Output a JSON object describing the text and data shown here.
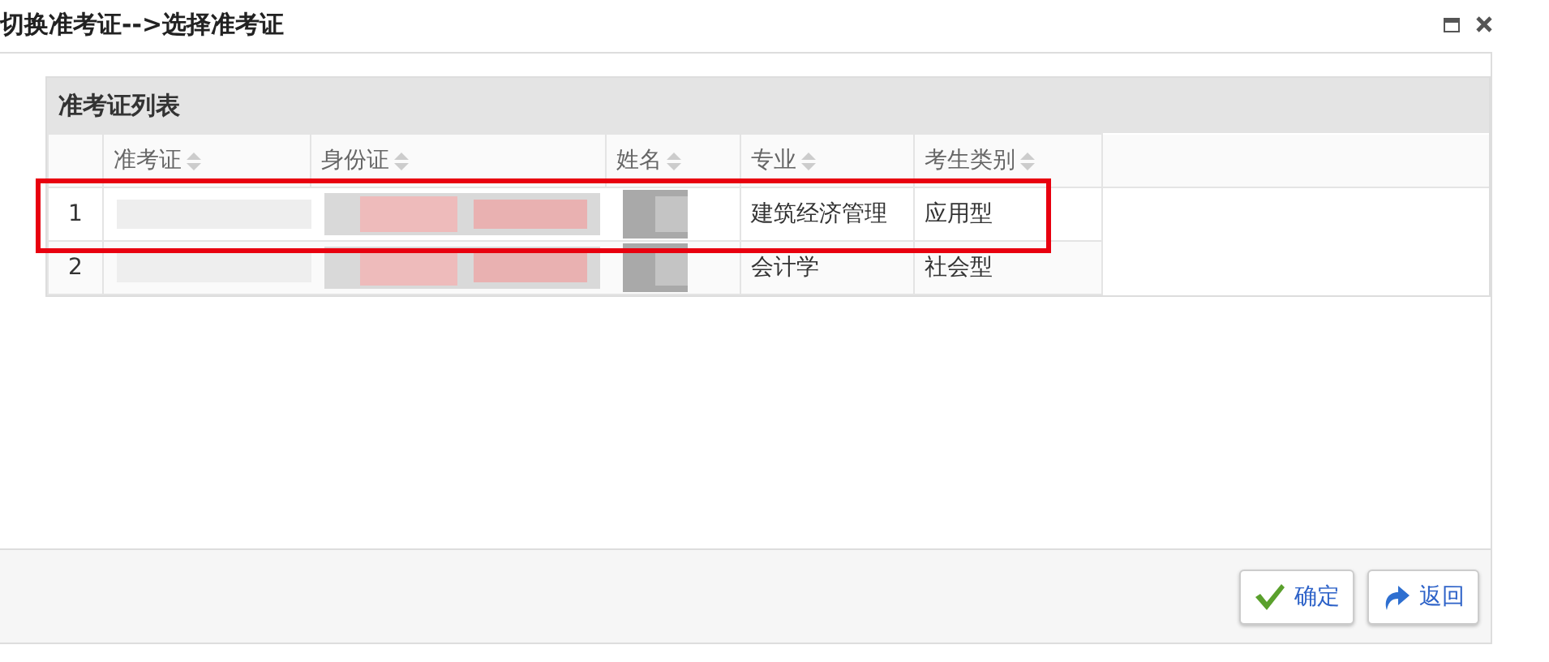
{
  "window": {
    "title": "切换准考证-->选择准考证"
  },
  "panel": {
    "title": "准考证列表"
  },
  "table": {
    "columns": [
      "准考证",
      "身份证",
      "姓名",
      "专业",
      "考生类别"
    ],
    "rows": [
      {
        "index": "1",
        "redacted": true,
        "major": "建筑经济管理",
        "category": "应用型",
        "highlighted": true
      },
      {
        "index": "2",
        "redacted": true,
        "major": "会计学",
        "category": "社会型",
        "highlighted": false
      }
    ]
  },
  "buttons": [
    {
      "kind": "confirm",
      "label": "确定"
    },
    {
      "kind": "back",
      "label": "返回"
    }
  ]
}
